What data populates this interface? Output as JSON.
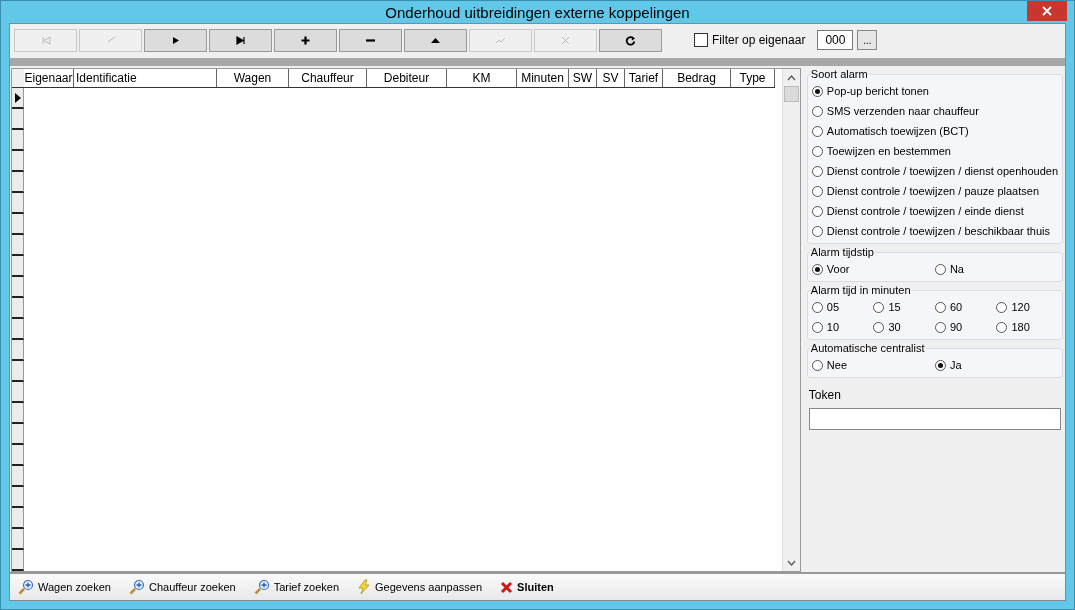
{
  "window": {
    "title": "Onderhoud uitbreidingen externe koppelingen"
  },
  "toolbar": {
    "buttons": [
      {
        "kind": "first",
        "disabled": true
      },
      {
        "kind": "prev",
        "disabled": true
      },
      {
        "kind": "next",
        "disabled": false
      },
      {
        "kind": "last",
        "disabled": false
      },
      {
        "kind": "add",
        "disabled": false
      },
      {
        "kind": "remove",
        "disabled": false
      },
      {
        "kind": "up",
        "disabled": false
      },
      {
        "kind": "confirm",
        "disabled": true
      },
      {
        "kind": "cancel",
        "disabled": true
      },
      {
        "kind": "refresh",
        "disabled": false
      }
    ],
    "filter": {
      "label": "Filter op eigenaar",
      "checked": false,
      "value": "000",
      "browse": "..."
    }
  },
  "table": {
    "columns": [
      "Eigenaar",
      "Identificatie",
      "Wagen",
      "Chauffeur",
      "Debiteur",
      "KM",
      "Minuten",
      "SW",
      "SV",
      "Tarief",
      "Bedrag",
      "Type"
    ],
    "row_selectors": [
      {
        "current": true
      },
      {
        "current": false
      },
      {
        "current": false
      },
      {
        "current": false
      },
      {
        "current": false
      },
      {
        "current": false
      },
      {
        "current": false
      },
      {
        "current": false
      },
      {
        "current": false
      },
      {
        "current": false
      },
      {
        "current": false
      },
      {
        "current": false
      },
      {
        "current": false
      },
      {
        "current": false
      },
      {
        "current": false
      },
      {
        "current": false
      },
      {
        "current": false
      },
      {
        "current": false
      },
      {
        "current": false
      },
      {
        "current": false
      },
      {
        "current": false
      },
      {
        "current": false
      },
      {
        "current": false
      }
    ]
  },
  "panel": {
    "groups": [
      {
        "title": "Soort alarm",
        "options": [
          {
            "label": "Pop-up bericht tonen",
            "selected": true
          },
          {
            "label": "SMS verzenden naar chauffeur",
            "selected": false
          },
          {
            "label": "Automatisch toewijzen (BCT)",
            "selected": false
          },
          {
            "label": "Toewijzen en bestemmen",
            "selected": false
          },
          {
            "label": "Dienst controle / toewijzen / dienst openhouden",
            "selected": false
          },
          {
            "label": "Dienst controle / toewijzen / pauze plaatsen",
            "selected": false
          },
          {
            "label": "Dienst controle / toewijzen / einde dienst",
            "selected": false
          },
          {
            "label": "Dienst controle / toewijzen / beschikbaar thuis",
            "selected": false
          }
        ]
      },
      {
        "title": "Alarm tijdstip",
        "options": [
          {
            "label": "Voor",
            "selected": true
          },
          {
            "label": "Na",
            "selected": false
          }
        ]
      },
      {
        "title": "Alarm tijd in minuten",
        "options": [
          {
            "label": "05",
            "selected": false
          },
          {
            "label": "15",
            "selected": false
          },
          {
            "label": "60",
            "selected": false
          },
          {
            "label": "120",
            "selected": false
          },
          {
            "label": "10",
            "selected": false
          },
          {
            "label": "30",
            "selected": false
          },
          {
            "label": "90",
            "selected": false
          },
          {
            "label": "180",
            "selected": false
          }
        ]
      },
      {
        "title": "Automatische centralist",
        "options": [
          {
            "label": "Nee",
            "selected": false
          },
          {
            "label": "Ja",
            "selected": true
          }
        ]
      }
    ],
    "token": {
      "label": "Token"
    }
  },
  "bottom_bar": [
    {
      "kind": "search",
      "label": "Wagen zoeken"
    },
    {
      "kind": "search",
      "label": "Chauffeur zoeken"
    },
    {
      "kind": "search",
      "label": "Tarief zoeken"
    },
    {
      "kind": "lightning",
      "label": "Gegevens aanpassen"
    },
    {
      "kind": "close",
      "label": "Sluiten"
    }
  ]
}
